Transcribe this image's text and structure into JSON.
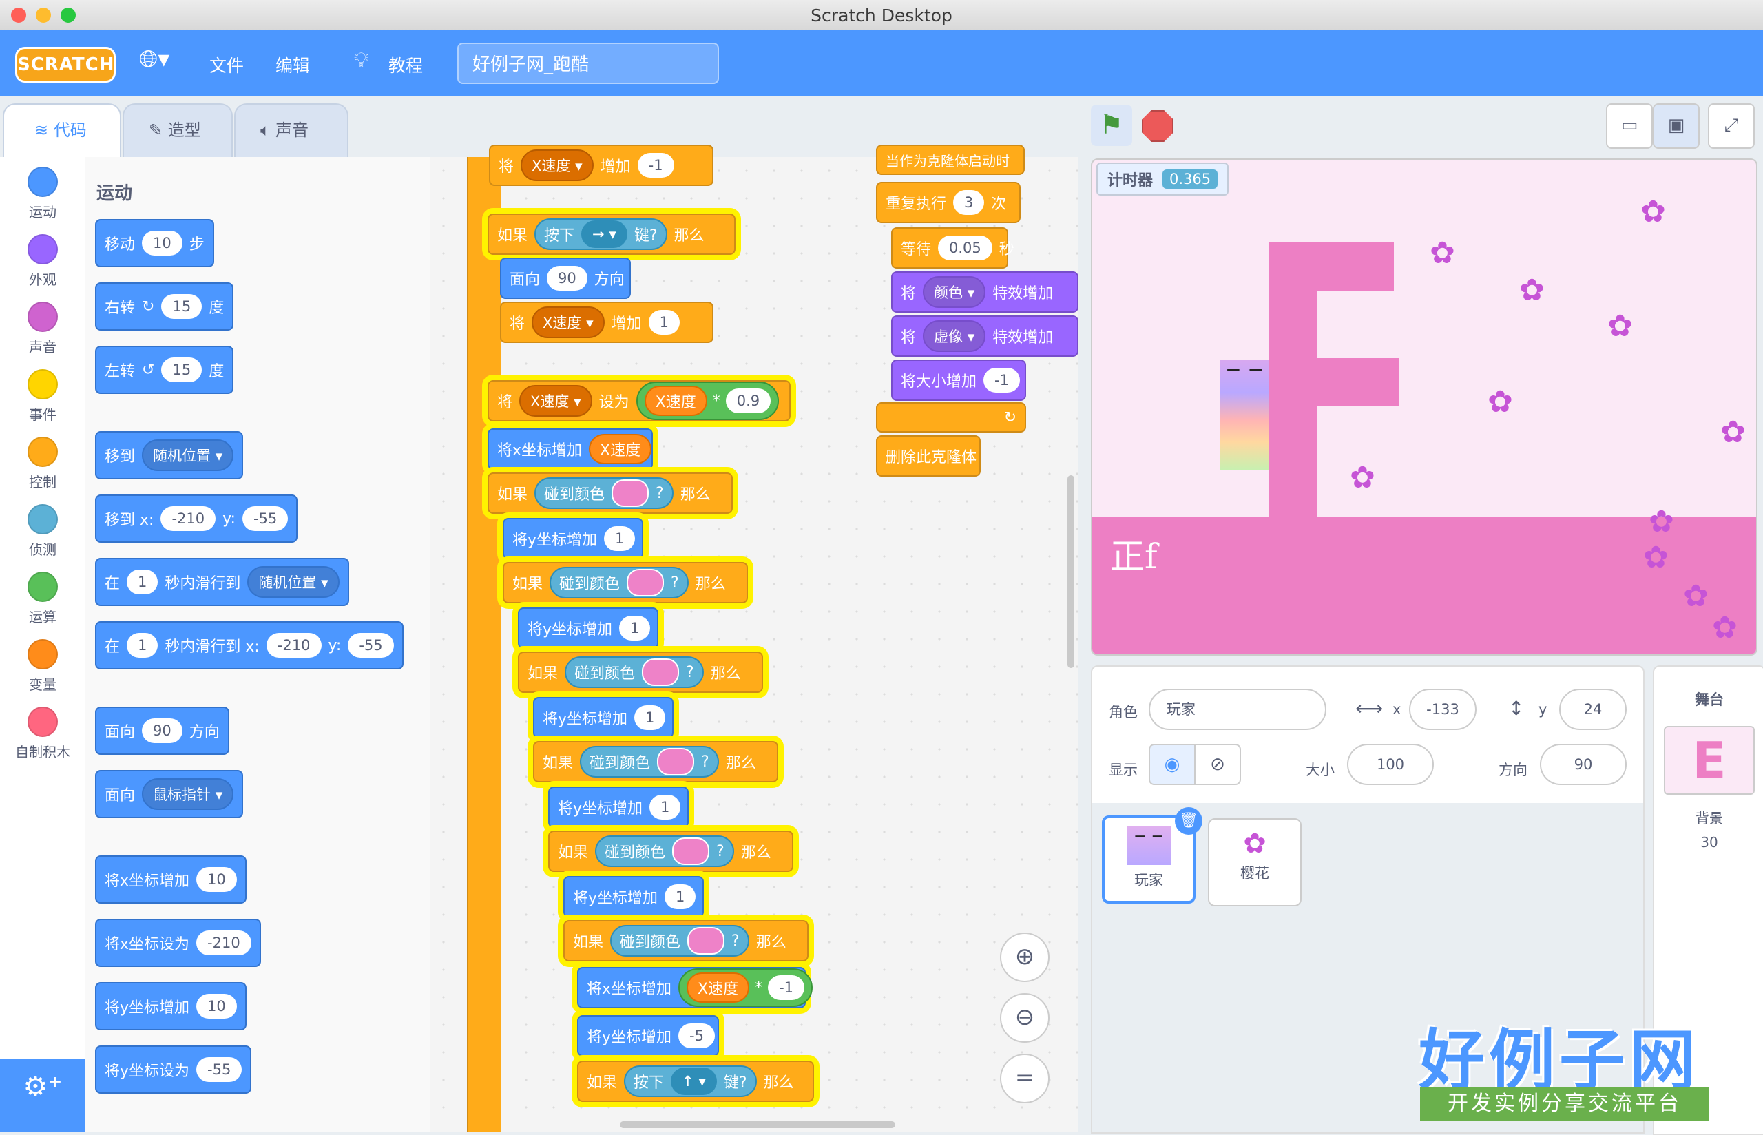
{
  "window": {
    "title": "Scratch Desktop"
  },
  "menubar": {
    "logo": "SCRATCH",
    "file": "文件",
    "edit": "编辑",
    "tutorials": "教程",
    "project_title": "好例子网_跑酷"
  },
  "tabs": {
    "code": "代码",
    "costumes": "造型",
    "sounds": "声音"
  },
  "categories": [
    {
      "label": "运动",
      "color": "#4c97ff"
    },
    {
      "label": "外观",
      "color": "#9966ff"
    },
    {
      "label": "声音",
      "color": "#cf63cf"
    },
    {
      "label": "事件",
      "color": "#ffd500"
    },
    {
      "label": "控制",
      "color": "#ffab19"
    },
    {
      "label": "侦测",
      "color": "#5cb1d6"
    },
    {
      "label": "运算",
      "color": "#59c059"
    },
    {
      "label": "变量",
      "color": "#ff8c1a"
    },
    {
      "label": "自制积木",
      "color": "#ff6680"
    }
  ],
  "palette": {
    "section": "运动",
    "move": {
      "a": "移动",
      "v": "10",
      "b": "步"
    },
    "turn_right": {
      "a": "右转",
      "v": "15",
      "b": "度"
    },
    "turn_left": {
      "a": "左转",
      "v": "15",
      "b": "度"
    },
    "goto": {
      "a": "移到",
      "dd": "随机位置"
    },
    "goto_xy": {
      "a": "移到 x:",
      "x": "-210",
      "y_l": "y:",
      "y": "-55"
    },
    "glide": {
      "a": "在",
      "v": "1",
      "b": "秒内滑行到",
      "dd": "随机位置"
    },
    "glide_xy": {
      "a": "在",
      "v": "1",
      "b": "秒内滑行到 x:",
      "x": "-210",
      "y_l": "y:",
      "y": "-55"
    },
    "point_dir": {
      "a": "面向",
      "v": "90",
      "b": "方向"
    },
    "point_towards": {
      "a": "面向",
      "dd": "鼠标指针"
    },
    "change_x": {
      "a": "将x坐标增加",
      "v": "10"
    },
    "set_x": {
      "a": "将x坐标设为",
      "v": "-210"
    },
    "change_y": {
      "a": "将y坐标增加",
      "v": "10"
    },
    "set_y": {
      "a": "将y坐标设为",
      "v": "-55"
    }
  },
  "script": {
    "top_partial": {
      "a": "将",
      "dd": "X速度",
      "b": "增加",
      "v": "-1"
    },
    "if_key": {
      "if": "如果",
      "key": "按下",
      "dd": "→",
      "q": "键?",
      "then": "那么"
    },
    "face90": {
      "a": "面向",
      "v": "90",
      "b": "方向"
    },
    "chg_xspeed": {
      "a": "将",
      "dd": "X速度",
      "b": "增加",
      "v": "1"
    },
    "set_xspeed": {
      "a": "将",
      "dd": "X速度",
      "b": "设为",
      "var": "X速度",
      "op": "*",
      "v": "0.9"
    },
    "chg_x_var": {
      "a": "将x坐标增加",
      "var": "X速度"
    },
    "if_color1": {
      "if": "如果",
      "touch": "碰到颜色",
      "q": "?",
      "then": "那么"
    },
    "chg_y1": {
      "a": "将y坐标增加",
      "v": "1"
    },
    "chg_x_neg": {
      "a": "将x坐标增加",
      "var": "X速度",
      "op": "*",
      "v": "-1"
    },
    "chg_y_neg5": {
      "a": "将y坐标增加",
      "v": "-5"
    },
    "if_key_up": {
      "if": "如果",
      "key": "按下",
      "dd": "↑",
      "q": "键?",
      "then": "那么"
    },
    "clone_hat": "当作为克隆体启动时",
    "repeat": {
      "a": "重复执行",
      "v": "3",
      "b": "次"
    },
    "wait": {
      "a": "等待",
      "v": "0.05",
      "b": "秒"
    },
    "fx_color": {
      "a": "将",
      "dd": "颜色",
      "b": "特效增加"
    },
    "fx_ghost": {
      "a": "将",
      "dd": "虚像",
      "b": "特效增加"
    },
    "size": {
      "a": "将大小增加",
      "v": "-1"
    },
    "delete_clone": "删除此克隆体"
  },
  "stage": {
    "monitor_label": "计时器",
    "monitor_value": "0.365",
    "big_letter": "E",
    "ground_text": "正f"
  },
  "sprite_info": {
    "sprite_label": "角色",
    "sprite_name": "玩家",
    "x_label": "x",
    "x": "-133",
    "y_label": "y",
    "y": "24",
    "show_label": "显示",
    "size_label": "大小",
    "size": "100",
    "dir_label": "方向",
    "dir": "90"
  },
  "sprites": [
    "玩家",
    "樱花"
  ],
  "stage_panel": {
    "title": "舞台",
    "backdrop_label": "背景",
    "backdrop_count": "30"
  },
  "watermark": {
    "main": "好例子网",
    "sub": "开发实例分享交流平台"
  }
}
